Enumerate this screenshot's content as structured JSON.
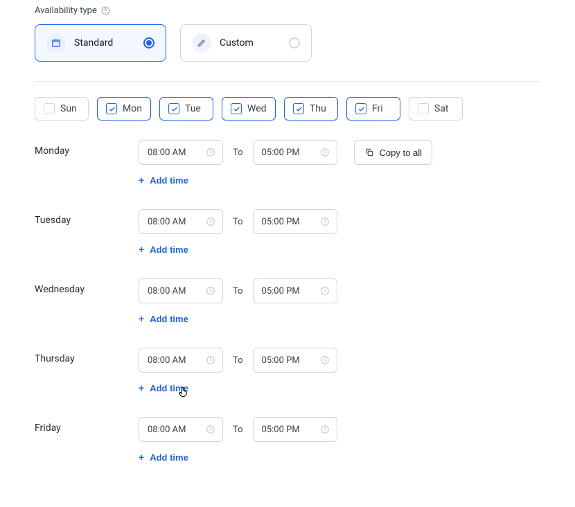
{
  "colors": {
    "primary": "#1d63ed",
    "border": "#d1d5db",
    "text": "#1f2937"
  },
  "heading": {
    "label": "Availability type"
  },
  "types": {
    "standard": {
      "label": "Standard",
      "selected": true
    },
    "custom": {
      "label": "Custom",
      "selected": false
    }
  },
  "days": {
    "sun": {
      "short": "Sun",
      "checked": false
    },
    "mon": {
      "short": "Mon",
      "checked": true
    },
    "tue": {
      "short": "Tue",
      "checked": true
    },
    "wed": {
      "short": "Wed",
      "checked": true
    },
    "thu": {
      "short": "Thu",
      "checked": true
    },
    "fri": {
      "short": "Fri",
      "checked": true
    },
    "sat": {
      "short": "Sat",
      "checked": false
    }
  },
  "labels": {
    "to": "To",
    "copy_to_all": "Copy to all",
    "add_time": "Add time"
  },
  "schedule": {
    "monday": {
      "label": "Monday",
      "start": "08:00 AM",
      "end": "05:00 PM"
    },
    "tuesday": {
      "label": "Tuesday",
      "start": "08:00 AM",
      "end": "05:00 PM"
    },
    "wednesday": {
      "label": "Wednesday",
      "start": "08:00 AM",
      "end": "05:00 PM"
    },
    "thursday": {
      "label": "Thursday",
      "start": "08:00 AM",
      "end": "05:00 PM"
    },
    "friday": {
      "label": "Friday",
      "start": "08:00 AM",
      "end": "05:00 PM"
    }
  }
}
